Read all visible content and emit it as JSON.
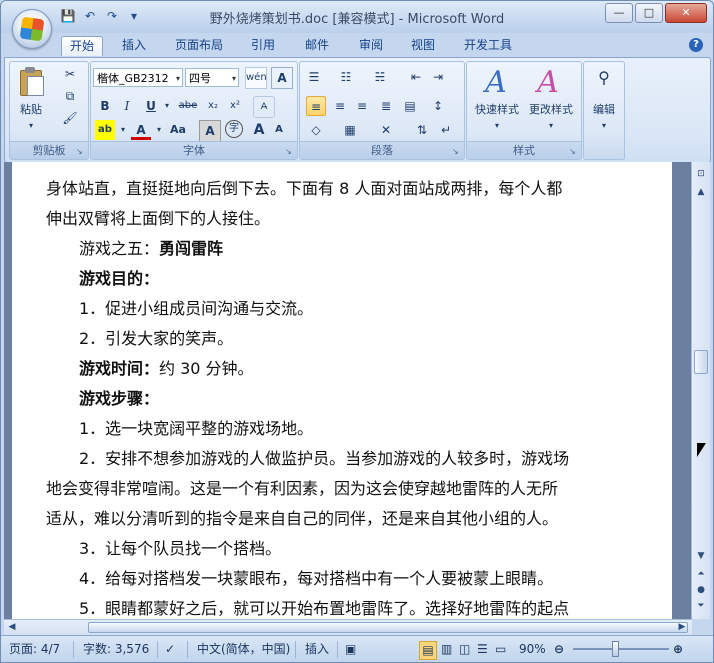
{
  "window": {
    "title": "野外烧烤策划书.doc [兼容模式] - Microsoft Word",
    "buttons": {
      "minimize": "—",
      "maximize": "□",
      "close": "✕"
    }
  },
  "quick_access": {
    "save_icon": "save-icon",
    "undo_icon": "undo-icon",
    "redo_icon": "redo-icon",
    "customize_icon": "customize-icon"
  },
  "tabs": [
    "开始",
    "插入",
    "页面布局",
    "引用",
    "邮件",
    "审阅",
    "视图",
    "开发工具"
  ],
  "active_tab": "开始",
  "ribbon": {
    "clipboard": {
      "label": "剪贴板",
      "paste": "粘贴"
    },
    "font": {
      "label": "字体",
      "font_name": "楷体_GB2312",
      "font_size": "四号",
      "bold": "B",
      "italic": "I",
      "underline": "U",
      "strike": "abe",
      "subscript": "x₂",
      "superscript": "x²",
      "change_case": "Aa",
      "grow": "A",
      "shrink": "A"
    },
    "paragraph": {
      "label": "段落"
    },
    "styles": {
      "label": "样式",
      "quick_styles": "快速样式",
      "change_styles": "更改样式"
    },
    "editing": {
      "label": "编辑"
    }
  },
  "document": {
    "paragraphs": [
      {
        "indent": false,
        "parts": [
          {
            "text": "身体站直，直挺挺地向后倒下去。下面有 8 人面对面站成两排，每个人都",
            "bold": false
          }
        ]
      },
      {
        "indent": false,
        "parts": [
          {
            "text": "伸出双臂将上面倒下的人接住。",
            "bold": false
          }
        ]
      },
      {
        "indent": true,
        "parts": [
          {
            "text": "游戏之五：",
            "bold": false
          },
          {
            "text": "勇闯雷阵",
            "bold": true
          }
        ]
      },
      {
        "indent": true,
        "parts": [
          {
            "text": "游戏目的：",
            "bold": true
          }
        ]
      },
      {
        "indent": true,
        "parts": [
          {
            "text": "1．促进小组成员间沟通与交流。",
            "bold": false
          }
        ]
      },
      {
        "indent": true,
        "parts": [
          {
            "text": "2．引发大家的笑声。",
            "bold": false
          }
        ]
      },
      {
        "indent": true,
        "parts": [
          {
            "text": "游戏时间：",
            "bold": true
          },
          {
            "text": "约 30 分钟。",
            "bold": false
          }
        ]
      },
      {
        "indent": true,
        "parts": [
          {
            "text": "游戏步骤：",
            "bold": true
          }
        ]
      },
      {
        "indent": true,
        "parts": [
          {
            "text": "1．选一块宽阔平整的游戏场地。",
            "bold": false
          }
        ]
      },
      {
        "indent": true,
        "parts": [
          {
            "text": "2．安排不想参加游戏的人做监护员。当参加游戏的人较多时，游戏场",
            "bold": false
          }
        ]
      },
      {
        "indent": false,
        "parts": [
          {
            "text": "地会变得非常喧闹。这是一个有利因素，因为这会使穿越地雷阵的人无所",
            "bold": false
          }
        ]
      },
      {
        "indent": false,
        "parts": [
          {
            "text": "适从，难以分清听到的指令是来自自己的同伴，还是来自其他小组的人。",
            "bold": false
          }
        ]
      },
      {
        "indent": true,
        "parts": [
          {
            "text": "3．让每个队员找一个搭档。",
            "bold": false
          }
        ]
      },
      {
        "indent": true,
        "parts": [
          {
            "text": "4．给每对搭档发一块蒙眼布，每对搭档中有一个人要被蒙上眼睛。",
            "bold": false
          }
        ]
      },
      {
        "indent": true,
        "parts": [
          {
            "text": "5．眼睛都蒙好之后，就可以开始布置地雷阵了。选择好地雷阵的起点",
            "bold": false
          }
        ]
      }
    ]
  },
  "status": {
    "page": "页面: 4/7",
    "words": "字数: 3,576",
    "language": "中文(简体，中国)",
    "insert_mode": "插入",
    "zoom": "90%"
  }
}
